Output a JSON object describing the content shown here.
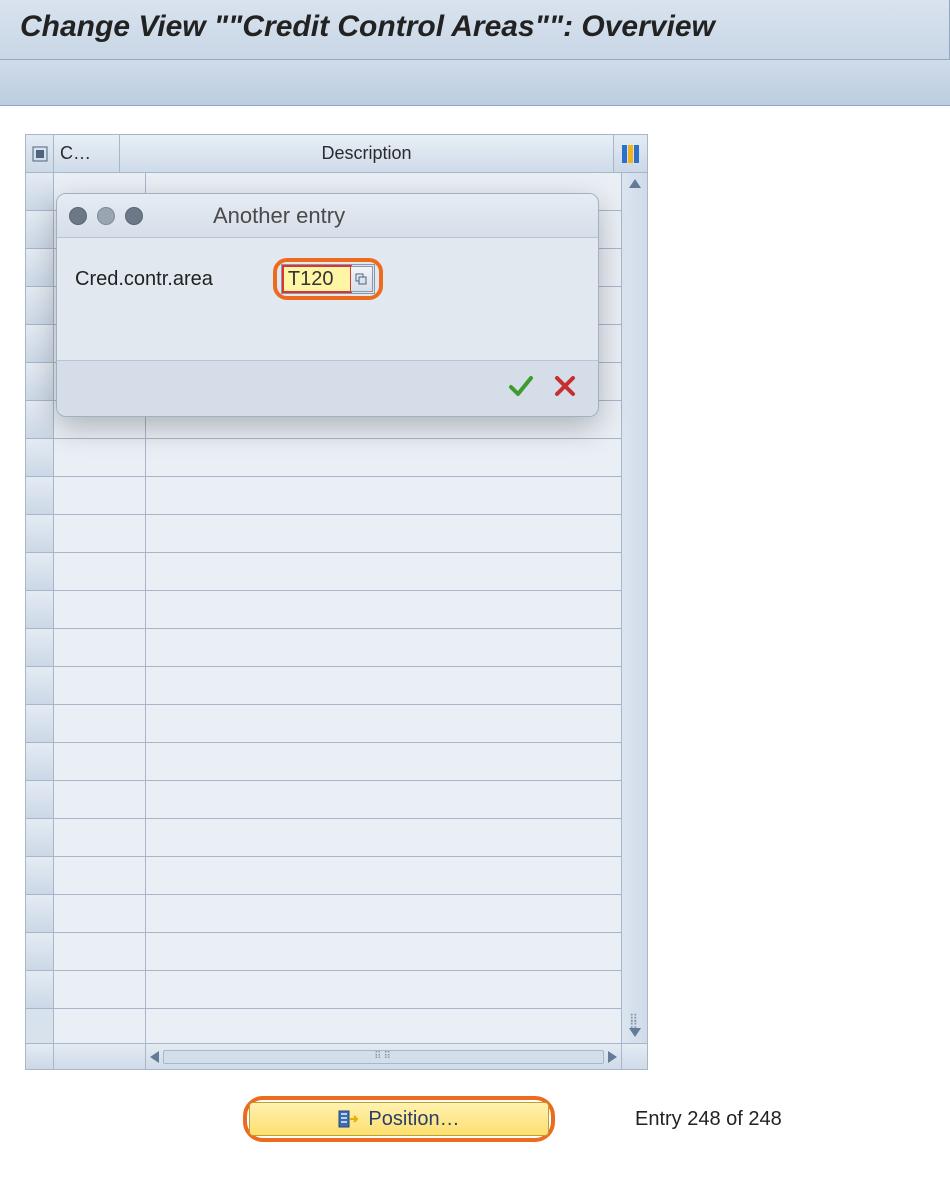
{
  "page": {
    "title": "Change View \"\"Credit Control Areas\"\": Overview"
  },
  "table": {
    "columns": {
      "code": "C…",
      "description": "Description"
    }
  },
  "dialog": {
    "title": "Another entry",
    "field_label": "Cred.contr.area",
    "field_value": "T120"
  },
  "footer": {
    "position_label": "Position…",
    "entry_text": "Entry 248 of 248"
  },
  "icons": {
    "select_all": "select-all-icon",
    "table_settings": "table-settings-icon",
    "search_help": "search-help-icon",
    "ok": "checkmark-icon",
    "cancel": "close-icon",
    "position": "position-icon"
  }
}
